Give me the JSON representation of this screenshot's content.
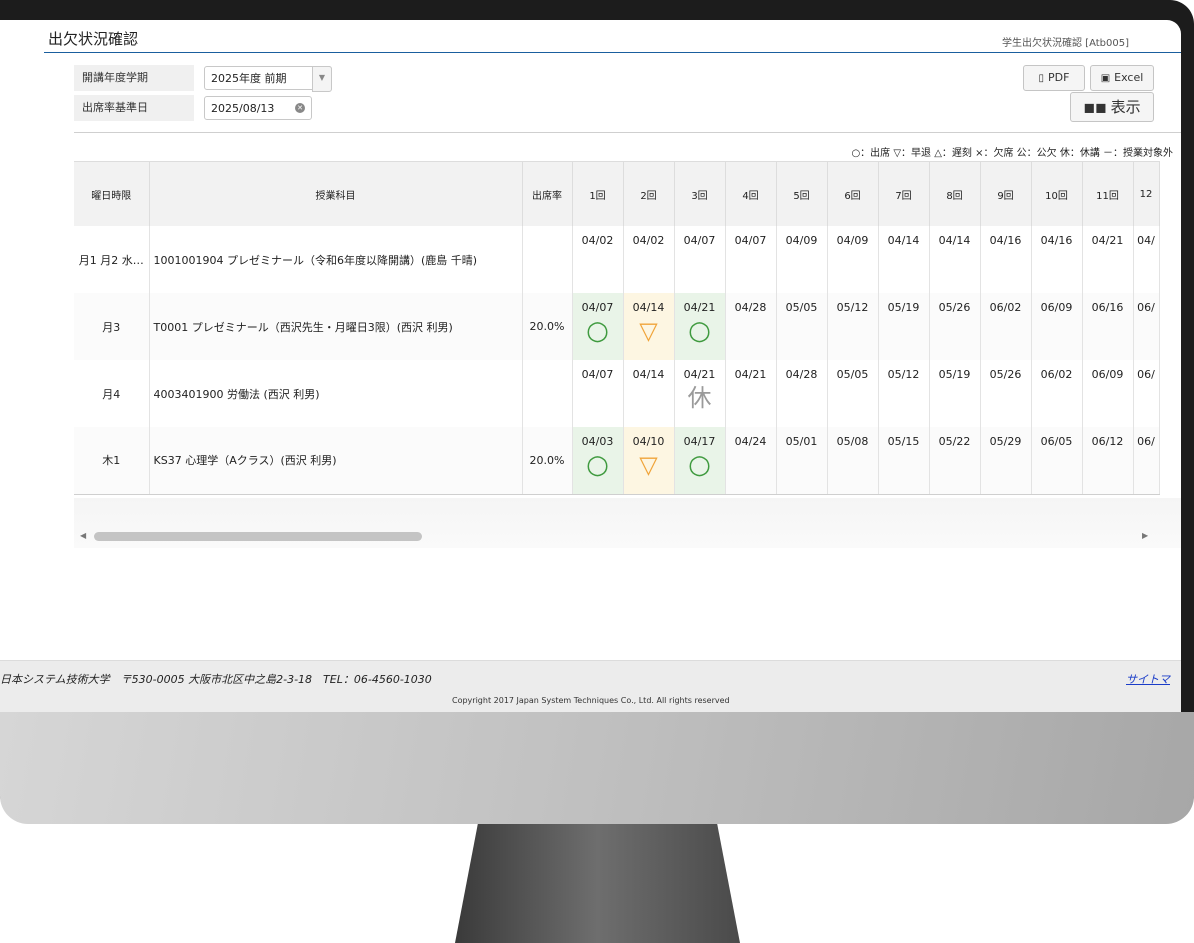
{
  "header": {
    "title": "出欠状況確認",
    "screen_id": "学生出欠状況確認 [Atb005]"
  },
  "filters": {
    "term_label": "開講年度学期",
    "term_value": "2025年度 前期",
    "base_date_label": "出席率基準日",
    "base_date_value": "2025/08/13"
  },
  "actions": {
    "pdf": "PDF",
    "excel": "Excel",
    "show": "表示"
  },
  "legend": "○：出席 ▽：早退 △：遅刻 ×：欠席 公：公欠 休：休講 －：授業対象外",
  "table": {
    "headers": [
      "曜日時限",
      "授業科目",
      "出席率",
      "1回",
      "2回",
      "3回",
      "4回",
      "5回",
      "6回",
      "7回",
      "8回",
      "9回",
      "10回",
      "11回",
      "12"
    ],
    "rows": [
      {
        "period": "月1 月2 水…",
        "subject": "1001001904 プレゼミナール（令和6年度以降開講）(鹿島 千晴)",
        "rate": "",
        "dates": [
          "04/02",
          "04/02",
          "04/07",
          "04/07",
          "04/09",
          "04/09",
          "04/14",
          "04/14",
          "04/16",
          "04/16",
          "04/21",
          "04/"
        ],
        "marks": [
          "",
          "",
          "",
          "",
          "",
          "",
          "",
          "",
          "",
          "",
          "",
          ""
        ]
      },
      {
        "period": "月3",
        "subject": "T0001 プレゼミナール（西沢先生・月曜日3限）(西沢 利男)",
        "rate": "20.0%",
        "dates": [
          "04/07",
          "04/14",
          "04/21",
          "04/28",
          "05/05",
          "05/12",
          "05/19",
          "05/26",
          "06/02",
          "06/09",
          "06/16",
          "06/"
        ],
        "marks": [
          "○",
          "▽",
          "○",
          "",
          "",
          "",
          "",
          "",
          "",
          "",
          "",
          ""
        ]
      },
      {
        "period": "月4",
        "subject": "4003401900 労働法 (西沢 利男)",
        "rate": "",
        "dates": [
          "04/07",
          "04/14",
          "04/21",
          "04/21",
          "04/28",
          "05/05",
          "05/12",
          "05/19",
          "05/26",
          "06/02",
          "06/09",
          "06/"
        ],
        "marks": [
          "",
          "",
          "休",
          "",
          "",
          "",
          "",
          "",
          "",
          "",
          "",
          ""
        ]
      },
      {
        "period": "木1",
        "subject": "KS37 心理学（Aクラス）(西沢 利男)",
        "rate": "20.0%",
        "dates": [
          "04/03",
          "04/10",
          "04/17",
          "04/24",
          "05/01",
          "05/08",
          "05/15",
          "05/22",
          "05/29",
          "06/05",
          "06/12",
          "06/"
        ],
        "marks": [
          "○",
          "▽",
          "○",
          "",
          "",
          "",
          "",
          "",
          "",
          "",
          "",
          ""
        ]
      }
    ]
  },
  "footer": {
    "address": "日本システム技術大学　〒530-0005 大阪市北区中之島2-3-18　TEL：06-4560-1030",
    "copyright": "Copyright 2017 Japan System Techniques Co., Ltd. All rights reserved",
    "sitemap": "サイトマ"
  }
}
